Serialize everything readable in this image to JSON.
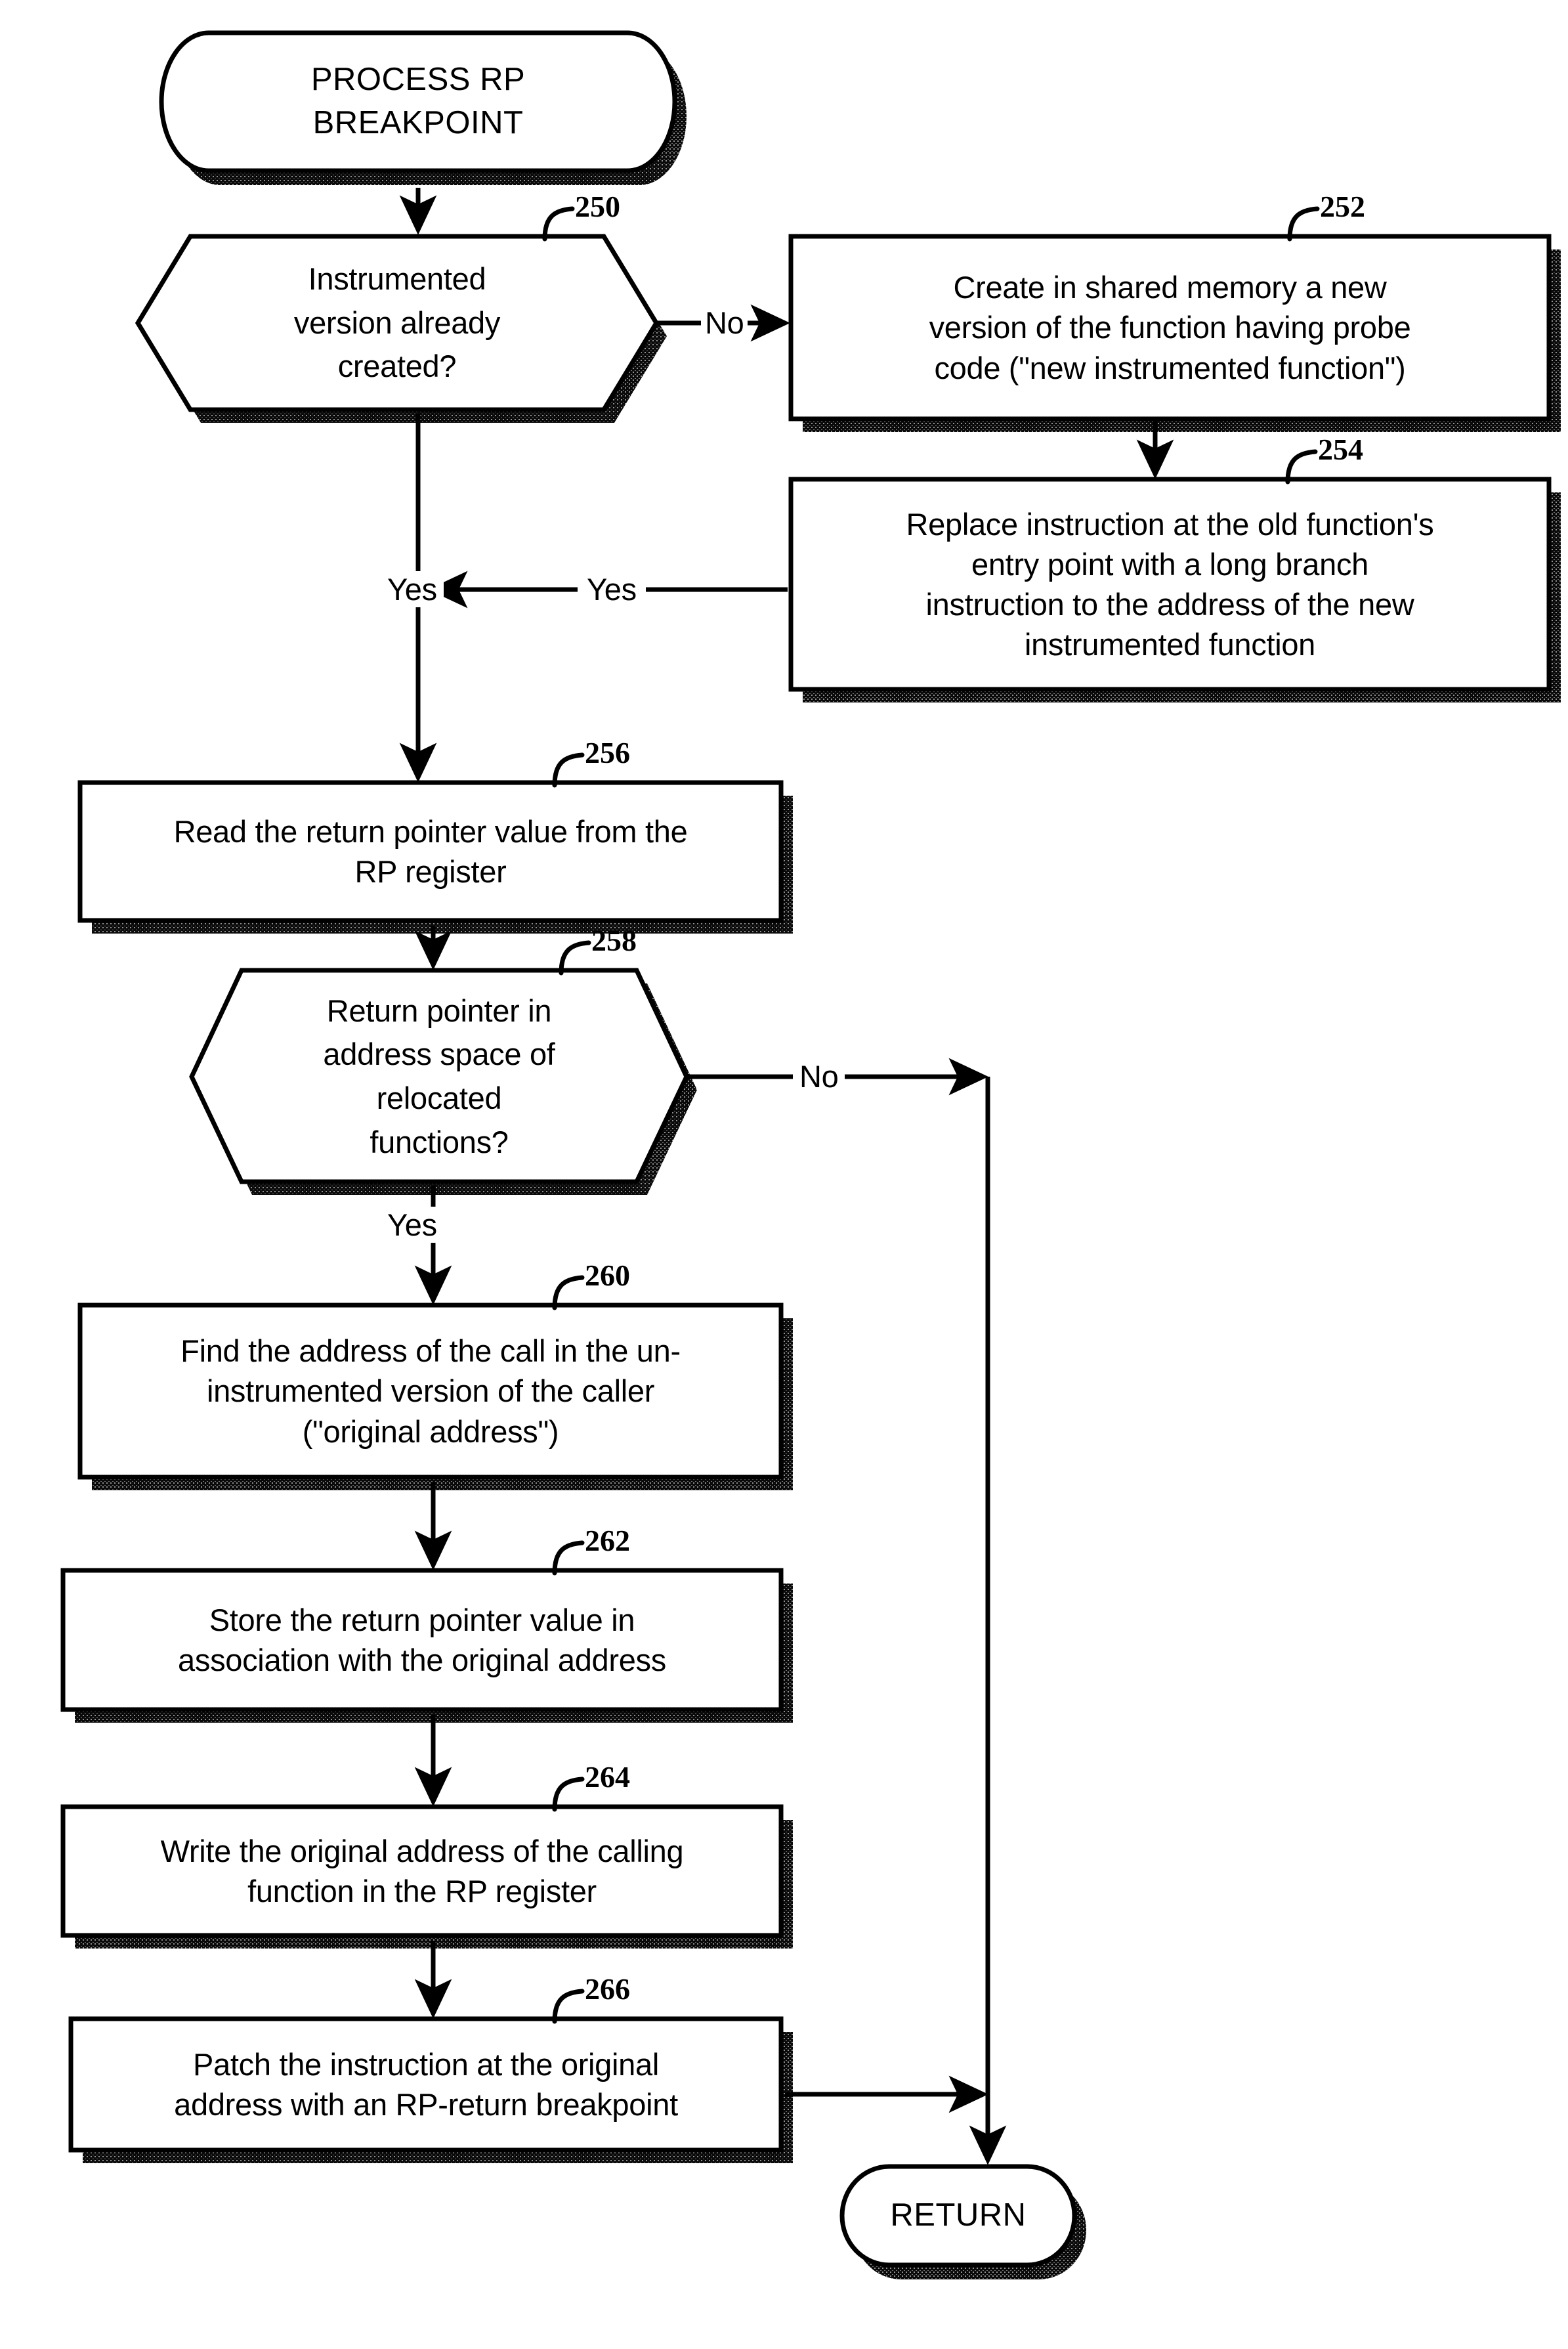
{
  "figure": {
    "type": "flowchart",
    "title": "PROCESS RP BREAKPOINT",
    "orientation": "top-to-bottom"
  },
  "nodes": {
    "start": {
      "shape": "terminator",
      "label": "PROCESS RP\nBREAKPOINT"
    },
    "d250": {
      "shape": "decision-hexagon",
      "ref": "250",
      "label": "Instrumented\nversion already\ncreated?"
    },
    "p252": {
      "shape": "process",
      "ref": "252",
      "label": "Create in shared memory a new\nversion of the function having probe\ncode (\"new instrumented function\")"
    },
    "p254": {
      "shape": "process",
      "ref": "254",
      "label": "Replace instruction at the old function's\nentry point with a long branch\ninstruction to the address of the new\ninstrumented function"
    },
    "p256": {
      "shape": "process",
      "ref": "256",
      "label": "Read the return pointer value from the\nRP register"
    },
    "d258": {
      "shape": "decision-hexagon",
      "ref": "258",
      "label": "Return pointer in\naddress space of\nrelocated\nfunctions?"
    },
    "p260": {
      "shape": "process",
      "ref": "260",
      "label": "Find the address of the call in the un-\ninstrumented version of the caller\n(\"original address\")"
    },
    "p262": {
      "shape": "process",
      "ref": "262",
      "label": "Store the return pointer value in\nassociation with the original address"
    },
    "p264": {
      "shape": "process",
      "ref": "264",
      "label": "Write the original address of the calling\nfunction in the RP register"
    },
    "p266": {
      "shape": "process",
      "ref": "266",
      "label": "Patch the instruction at the original\naddress with an RP-return breakpoint"
    },
    "end": {
      "shape": "terminator",
      "label": "RETURN"
    }
  },
  "edge_labels": {
    "d250_no": "No",
    "d250_yes_right": "Yes",
    "d250_yes_left": "Yes",
    "d258_no": "No",
    "d258_yes": "Yes"
  },
  "colors": {
    "stroke": "#000000",
    "fill": "#ffffff",
    "shadow": "#000000",
    "background": "#ffffff"
  }
}
